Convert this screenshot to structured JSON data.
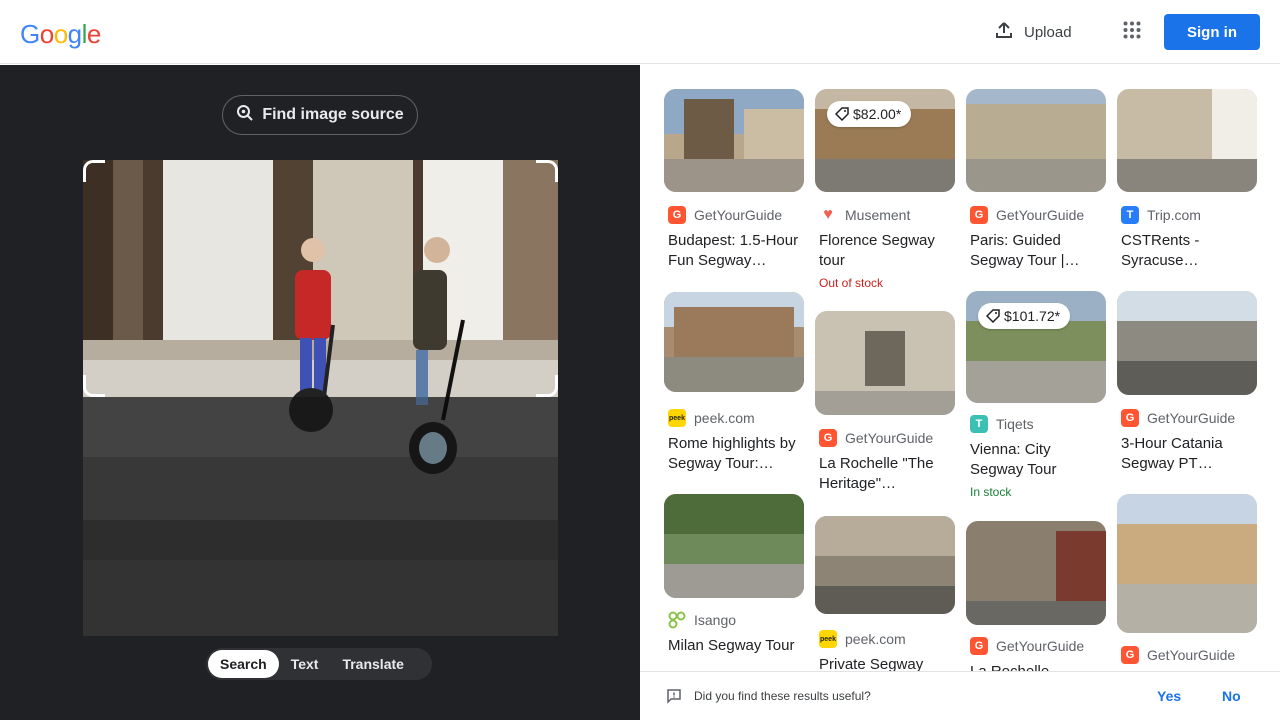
{
  "header": {
    "logo_letters": [
      "G",
      "o",
      "o",
      "g",
      "l",
      "e"
    ],
    "upload_label": "Upload",
    "signin_label": "Sign in",
    "colors": {
      "blue": "#4285f4",
      "red": "#ea4335",
      "yellow": "#fbbc05",
      "green": "#34a853",
      "accent": "#1a73e8"
    }
  },
  "lens": {
    "find_source_label": "Find image source",
    "tabs": [
      {
        "label": "Search",
        "active": true
      },
      {
        "label": "Text",
        "active": false
      },
      {
        "label": "Translate",
        "active": false
      }
    ]
  },
  "results": [
    {
      "source": "GetYourGuide",
      "favicon": "gyg-icon",
      "fav_color": "#ff5533",
      "fav_text": "G",
      "title": "Budapest: 1.5-Hour Fun Segway…",
      "price": "",
      "stock": ""
    },
    {
      "source": "Musement",
      "favicon": "heart-icon",
      "fav_color": "#f06050",
      "fav_text": "♥",
      "title": "Florence Segway tour",
      "price": "$82.00*",
      "stock": "Out of stock",
      "stock_color": "#c5221f"
    },
    {
      "source": "GetYourGuide",
      "favicon": "gyg-icon",
      "fav_color": "#ff5533",
      "fav_text": "G",
      "title": "Paris: Guided Segway Tour |…",
      "price": "",
      "stock": ""
    },
    {
      "source": "Trip.com",
      "favicon": "tripcom-icon",
      "fav_color": "#287dfa",
      "fav_text": "T",
      "title": "CSTRents - Syracuse Segway…",
      "price": "",
      "stock": ""
    },
    {
      "source": "peek.com",
      "favicon": "peek-icon",
      "fav_color": "#ffd600",
      "fav_text": "peek",
      "title": "Rome highlights by Segway Tour: Boo…",
      "price": "",
      "stock": ""
    },
    {
      "source": "GetYourGuide",
      "favicon": "gyg-icon",
      "fav_color": "#ff5533",
      "fav_text": "G",
      "title": "La Rochelle \"The Heritage\" Segway…",
      "price": "",
      "stock": ""
    },
    {
      "source": "Tiqets",
      "favicon": "tiqets-icon",
      "fav_color": "#3cc0b4",
      "fav_text": "T",
      "title": "Vienna: City Segway Tour",
      "price": "$101.72*",
      "stock": "In stock",
      "stock_color": "#188038"
    },
    {
      "source": "GetYourGuide",
      "favicon": "gyg-icon",
      "fav_color": "#ff5533",
      "fav_text": "G",
      "title": "3-Hour Catania Segway PT…",
      "price": "",
      "stock": ""
    },
    {
      "source": "Isango",
      "favicon": "isango-icon",
      "fav_color": "#8bc34a",
      "fav_text": "",
      "title": "Milan Segway Tour",
      "price": "",
      "stock": ""
    },
    {
      "source": "peek.com",
      "favicon": "peek-icon",
      "fav_color": "#ffd600",
      "fav_text": "peek",
      "title": "Private Segway",
      "price": "",
      "stock": ""
    },
    {
      "source": "GetYourGuide",
      "favicon": "gyg-icon",
      "fav_color": "#ff5533",
      "fav_text": "G",
      "title": "La Rochelle",
      "price": "",
      "stock": ""
    },
    {
      "source": "GetYourGuide",
      "favicon": "gyg-icon",
      "fav_color": "#ff5533",
      "fav_text": "G",
      "title": "",
      "price": "",
      "stock": ""
    }
  ],
  "feedback": {
    "question": "Did you find these results useful?",
    "yes_label": "Yes",
    "no_label": "No"
  }
}
